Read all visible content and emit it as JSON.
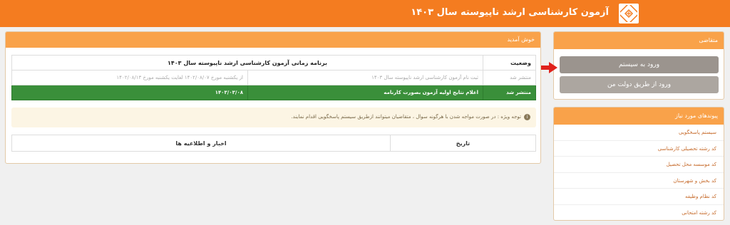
{
  "header": {
    "title": "آزمون کارشناسی ارشد ناپیوسته سال ۱۴۰۳",
    "bg_color": "#f47c20"
  },
  "login_panel": {
    "title": "متقاضی",
    "login_button": "ورود به سیستم",
    "dolat_button": "ورود از طریق دولت من"
  },
  "links_panel": {
    "title": "پیوندهای مورد نیاز",
    "items": [
      "سیستم پاسخگویی",
      "کد رشته تحصیلی کارشناسی",
      "کد موسسه محل تحصیل",
      "کد بخش و شهرستان",
      "کد نظام وظیفه",
      "کد رشته امتحانی"
    ]
  },
  "main_panel": {
    "title": "خوش آمدید",
    "schedule": {
      "header_status": "وضعیت",
      "header_title": "برنامه زمانی آزمون کارشناسی ارشد ناپیوسته سال ۱۴۰۳",
      "rows": [
        {
          "status": "منتشر شد",
          "title": "ثبت نام آزمون کارشناسی ارشد ناپیوسته سال ۱۴۰۳",
          "date": "از یکشنبه مورخ ۱۴۰۲/۰۸/۰۷ لغایت یکشنبه مورخ ۱۴۰۲/۰۸/۱۳",
          "active": false
        },
        {
          "status": "منتشر شد",
          "title": "اعلام نتایج اولیه آزمون بصورت کارنامه",
          "date": "۱۴۰۳/۰۳/۰۸",
          "active": true
        }
      ]
    },
    "notice": "توجه ویژه : در صورت مواجه شدن با هرگونه سوال ، متقاضیان میتوانند ازطریق سیستم پاسخگویی اقدام نمایند.",
    "news": {
      "col_date": "تاریخ",
      "col_news": "اخبار و اطلاعیه ها"
    }
  },
  "colors": {
    "accent": "#f47c20",
    "panel_head": "#f9a24a",
    "success": "#3a8f3a",
    "arrow": "#e0221c"
  }
}
